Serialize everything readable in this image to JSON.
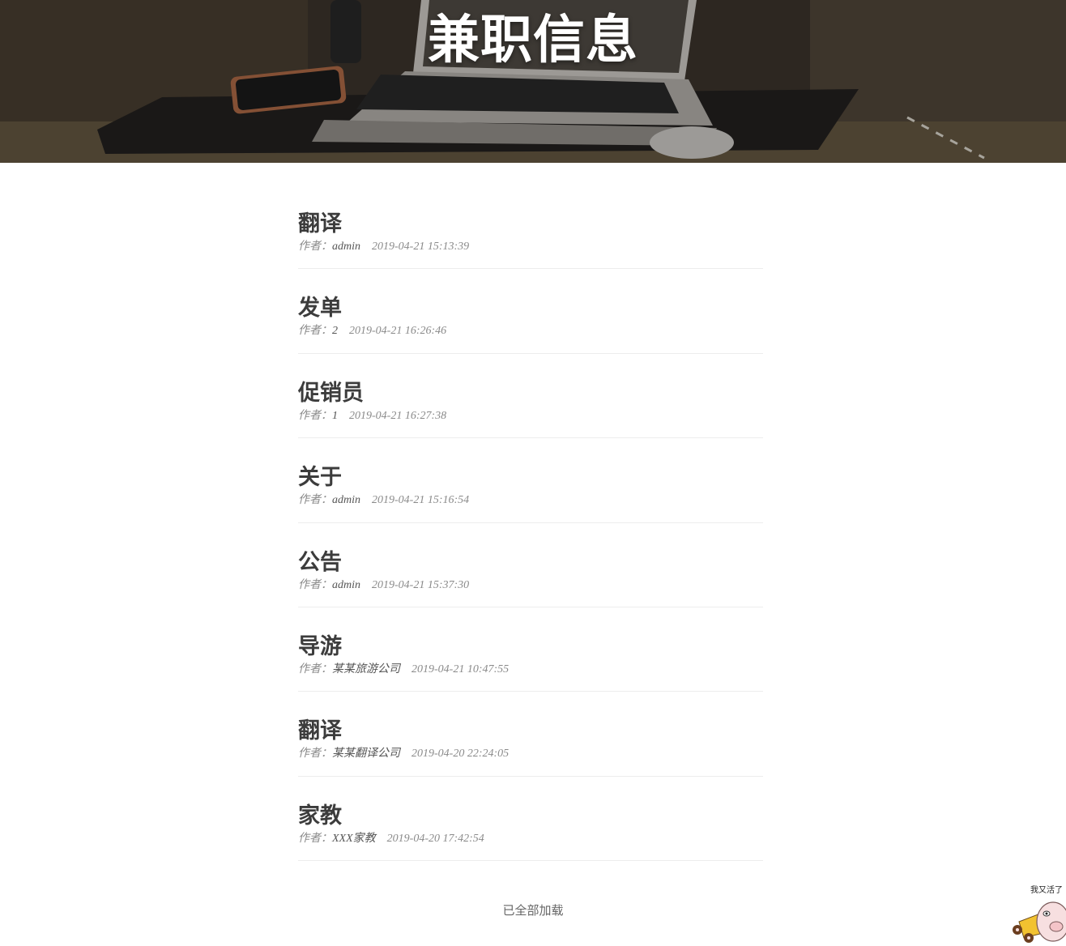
{
  "header": {
    "title": "兼职信息"
  },
  "posts": [
    {
      "title": "翻译",
      "author_label": "作者：",
      "author": "admin",
      "date": "2019-04-21 15:13:39"
    },
    {
      "title": "发单",
      "author_label": "作者：",
      "author": "2",
      "date": "2019-04-21 16:26:46"
    },
    {
      "title": "促销员",
      "author_label": "作者：",
      "author": "1",
      "date": "2019-04-21 16:27:38"
    },
    {
      "title": "关于",
      "author_label": "作者：",
      "author": "admin",
      "date": "2019-04-21 15:16:54"
    },
    {
      "title": "公告",
      "author_label": "作者：",
      "author": "admin",
      "date": "2019-04-21 15:37:30"
    },
    {
      "title": "导游",
      "author_label": "作者：",
      "author": "某某旅游公司",
      "date": "2019-04-21 10:47:55"
    },
    {
      "title": "翻译",
      "author_label": "作者：",
      "author": "某某翻译公司",
      "date": "2019-04-20 22:24:05"
    },
    {
      "title": "家教",
      "author_label": "作者：",
      "author": "XXX家教",
      "date": "2019-04-20 17:42:54"
    }
  ],
  "footer": {
    "load_status": "已全部加载"
  },
  "mascot": {
    "text": "我又活了"
  }
}
